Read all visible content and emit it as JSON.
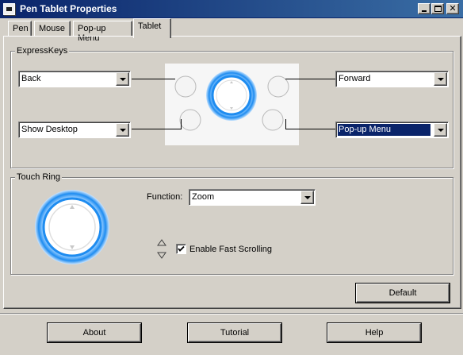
{
  "window": {
    "title": "Pen Tablet Properties",
    "title_icon": "tablet-icon",
    "minimize_icon": "minimize-icon",
    "maximize_icon": "maximize-icon",
    "close_icon": "close-icon"
  },
  "tabs": [
    {
      "label": "Pen",
      "active": false
    },
    {
      "label": "Mouse",
      "active": false
    },
    {
      "label": "Pop-up Menu",
      "active": false
    },
    {
      "label": "Tablet",
      "active": true
    }
  ],
  "expresskeys": {
    "label": "ExpressKeys",
    "top_left": "Back",
    "bottom_left": "Show Desktop",
    "top_right": "Forward",
    "bottom_right": "Pop-up Menu"
  },
  "touch_ring": {
    "label": "Touch Ring",
    "function_label": "Function:",
    "function_value": "Zoom",
    "fast_scrolling_label": "Enable Fast Scrolling",
    "fast_scrolling_checked": true,
    "scroll_icon": "up-down-arrows-icon"
  },
  "buttons": {
    "default": "Default",
    "about": "About",
    "tutorial": "Tutorial",
    "help": "Help"
  },
  "colors": {
    "accent_blue": "#1e8cf0",
    "titlebar": "#0a246a",
    "selection": "#0a246a"
  }
}
